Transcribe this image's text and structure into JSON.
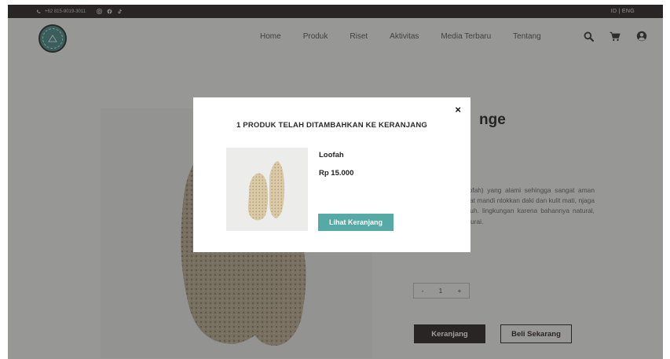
{
  "topbar": {
    "phone": "+62 815-9019-3011",
    "socials": [
      "instagram-icon",
      "facebook-icon",
      "tiktok-icon"
    ],
    "lang": "ID | ENG"
  },
  "header": {
    "nav": [
      "Home",
      "Produk",
      "Riset",
      "Aktivitas",
      "Media Terbaru",
      "Tentang"
    ]
  },
  "product": {
    "title_visible": "nge",
    "description": "buhan gambas (loofah) yang alami sehingga sangat aman ponge pada kulit saat mandi ntokkan daki dan kulit mati, njaga kesehatan kulit tubuh. lingkungan karena bahannya natural, sehingga mudah terurai.",
    "qty_minus": "-",
    "qty_value": "1",
    "qty_plus": "+",
    "cart_button": "Keranjang",
    "buy_button": "Beli Sekarang"
  },
  "modal": {
    "close": "×",
    "title": "1 PRODUK TELAH DITAMBAHKAN KE KERANJANG",
    "product_name": "Loofah",
    "product_price": "Rp 15.000",
    "view_cart_button": "Lihat Keranjang"
  },
  "colors": {
    "dark": "#2a2424",
    "accent": "#56aaa6",
    "logo": "#4a8a86",
    "page_bg": "#f3f3f1"
  }
}
